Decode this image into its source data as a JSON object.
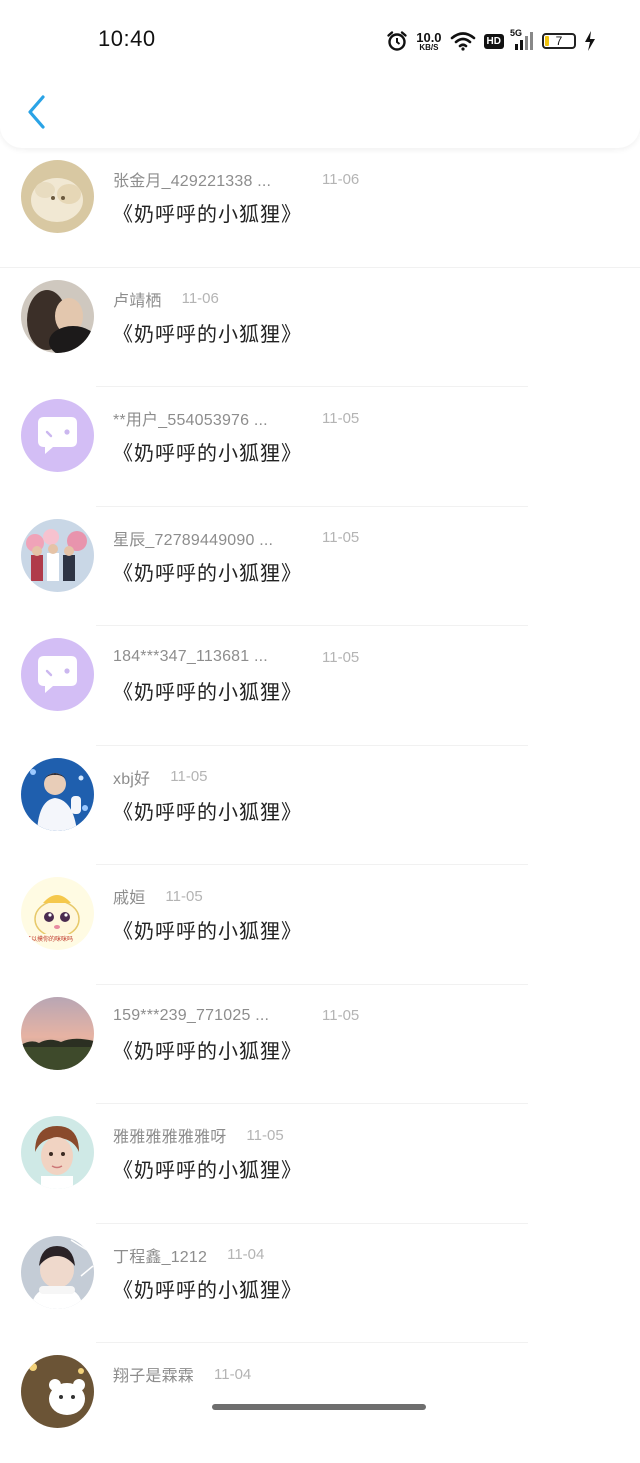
{
  "status_bar": {
    "time": "10:40",
    "net_speed_value": "10.0",
    "net_speed_unit": "KB/S",
    "hd_label": "HD",
    "signal_label": "5G",
    "battery_level": "7",
    "icons": [
      "alarm-icon",
      "wifi-icon",
      "cellular-signal-icon",
      "battery-icon",
      "charging-icon"
    ]
  },
  "nav": {
    "back_icon": "chevron-left-icon",
    "accent_color": "#2aa3e6"
  },
  "items": [
    {
      "name": "张金月_429221338 ...",
      "date": "11-06",
      "comment": "《奶呼呼的小狐狸》"
    },
    {
      "name": "卢靖栖",
      "date": "11-06",
      "comment": "《奶呼呼的小狐狸》"
    },
    {
      "name": "**用户_554053976 ...",
      "date": "11-05",
      "comment": "《奶呼呼的小狐狸》"
    },
    {
      "name": "星辰_72789449090 ...",
      "date": "11-05",
      "comment": "《奶呼呼的小狐狸》"
    },
    {
      "name": "184***347_113681 ...",
      "date": "11-05",
      "comment": "《奶呼呼的小狐狸》"
    },
    {
      "name": "xbj好",
      "date": "11-05",
      "comment": "《奶呼呼的小狐狸》"
    },
    {
      "name": "戚姮",
      "date": "11-05",
      "comment": "《奶呼呼的小狐狸》"
    },
    {
      "name": "159***239_771025 ...",
      "date": "11-05",
      "comment": "《奶呼呼的小狐狸》"
    },
    {
      "name": "雅雅雅雅雅雅呀",
      "date": "11-05",
      "comment": "《奶呼呼的小狐狸》"
    },
    {
      "name": "丁程鑫_1212",
      "date": "11-04",
      "comment": "《奶呼呼的小狐狸》"
    },
    {
      "name": "翔子是霖霖",
      "date": "11-04",
      "comment": ""
    }
  ],
  "avatar_sticker_text": "可以摸你的咪咪吗",
  "default_avatar_color": "#d3bef5"
}
